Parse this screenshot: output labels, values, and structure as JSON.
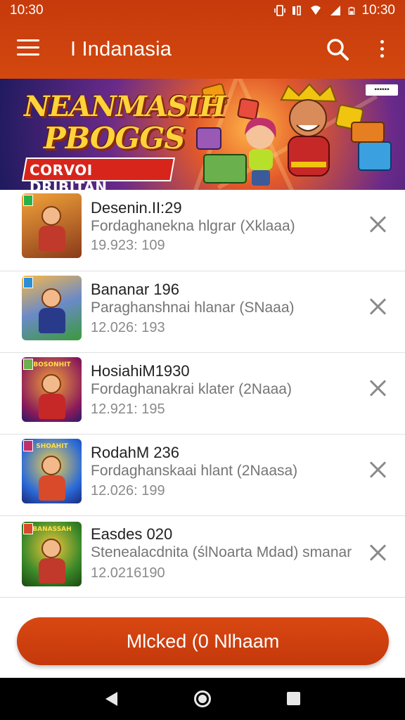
{
  "status_bar": {
    "time": "10:30",
    "clock_right": "10:30"
  },
  "app_bar": {
    "title": "I Indanasia"
  },
  "banner": {
    "title_line1": "NEANMASIH",
    "title_line2": "PBOGGS",
    "ribbon": "CORVOI DRIBITAN",
    "badge": "▪▪▪▪▪▪"
  },
  "items": [
    {
      "name": "Desenin.II:29",
      "description": "Fordaghanekna hlgrar (Xklaaa)",
      "size": "19.923: 109",
      "thumb_label": "",
      "thumb_color": "#c9672a"
    },
    {
      "name": "Bananar 196",
      "description": "Paraghanshnai hlanar (SNaaa)",
      "size": "12.026: 193",
      "thumb_label": "",
      "thumb_color": "#4a7bc0"
    },
    {
      "name": "HosiahiM1930",
      "description": "Fordaghanakrai klater (2Naaa)",
      "size": "12.921: 195",
      "thumb_label": "BOSONHIT",
      "thumb_color": "#b8321c"
    },
    {
      "name": "RodahM 236",
      "description": "Fordaghanskaai hlant (2Naasa)",
      "size": "12.026: 199",
      "thumb_label": "SHOAHIT",
      "thumb_color": "#2a64c8"
    },
    {
      "name": "Easdes 020",
      "description": "Stenealacdnita (ślNoarta Mdad) smanar",
      "size": "12.0216190",
      "thumb_label": "BANASSAH",
      "thumb_color": "#3c8a2a"
    }
  ],
  "action": {
    "label": "Mlcked (0 Nlhaam"
  },
  "colors": {
    "primary": "#c63a0c",
    "text_primary": "#222222",
    "text_secondary": "#757575"
  },
  "icons": [
    "menu-icon",
    "search-icon",
    "more-vert-icon",
    "close-icon",
    "nav-back-icon",
    "nav-home-icon",
    "nav-recent-icon"
  ]
}
